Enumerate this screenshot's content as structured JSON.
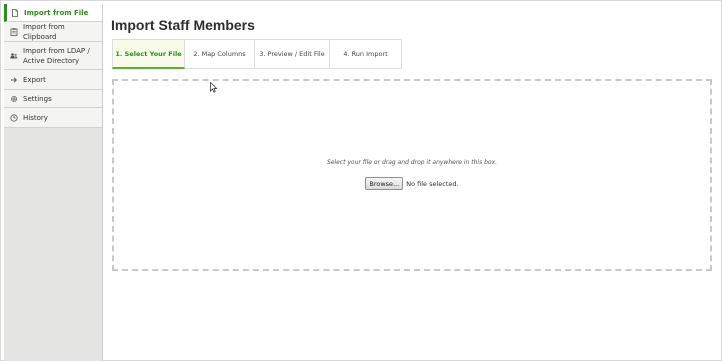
{
  "sidebar": {
    "items": [
      {
        "label_lines": [
          "Import from File"
        ],
        "icon": "document-icon",
        "active": true
      },
      {
        "label_lines": [
          "Import from Clipboard"
        ],
        "icon": "clipboard-icon",
        "active": false
      },
      {
        "label_lines": [
          "Import from LDAP /",
          "Active Directory"
        ],
        "icon": "users-icon",
        "active": false
      },
      {
        "label_lines": [
          "Export"
        ],
        "icon": "arrow-right-icon",
        "active": false
      },
      {
        "label_lines": [
          "Settings"
        ],
        "icon": "gear-icon",
        "active": false
      },
      {
        "label_lines": [
          "History"
        ],
        "icon": "clock-icon",
        "active": false
      }
    ]
  },
  "main": {
    "title": "Import Staff Members",
    "steps": [
      {
        "label": "1. Select Your File",
        "active": true
      },
      {
        "label": "2. Map Columns",
        "active": false
      },
      {
        "label": "3. Preview / Edit File",
        "active": false
      },
      {
        "label": "4. Run Import",
        "active": false
      }
    ],
    "dropzone": {
      "instruction": "Select your file or drag and drop it anywhere in this box.",
      "browse_label": "Browse...",
      "file_status": "No file selected."
    }
  },
  "colors": {
    "accent": "#2f8a1f",
    "active_tab_bg": "#f7fbe8",
    "sidebar_bg": "#e4e4e2"
  }
}
